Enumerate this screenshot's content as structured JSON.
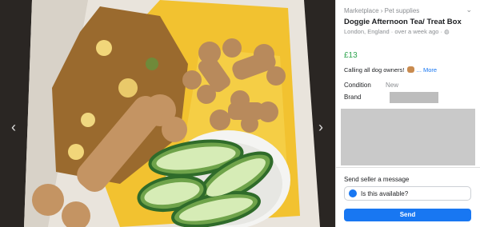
{
  "listing": {
    "breadcrumb": "Marketplace › Pet supplies",
    "title": "Doggie Afternoon Tea/ Treat Box",
    "location": "London, England · over a week ago ·",
    "price": "£13",
    "description": "Calling all dog owners!",
    "more_label": "... More",
    "condition_label": "Condition",
    "condition_value": "New",
    "brand_label": "Brand"
  },
  "message": {
    "section_label": "Send seller a message",
    "placeholder_text": "Is this available?",
    "send_label": "Send"
  },
  "icons": {
    "prev": "chevron-left-icon",
    "next": "chevron-right-icon",
    "collapse": "chevron-down-icon",
    "messenger": "messenger-icon",
    "globe": "globe-icon"
  },
  "colors": {
    "price": "#2ea44f",
    "accent": "#1877f2"
  }
}
